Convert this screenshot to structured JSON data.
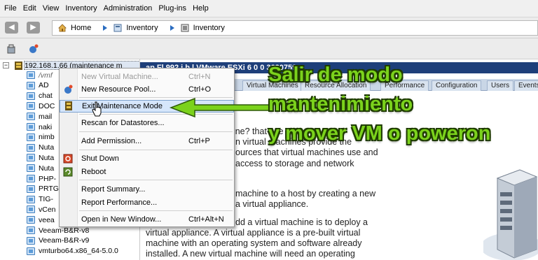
{
  "menubar": [
    "File",
    "Edit",
    "View",
    "Inventory",
    "Administration",
    "Plug-ins",
    "Help"
  ],
  "breadcrumb": [
    {
      "label": "Home",
      "icon": "home-icon"
    },
    {
      "label": "Inventory",
      "icon": "inventory-icon"
    },
    {
      "label": "Inventory",
      "icon": "inventory-icon"
    }
  ],
  "tree": {
    "host": "192.168.1.66 (maintenance m",
    "items": [
      "/vmf",
      "AD",
      "chat",
      "DOC",
      "mail",
      "naki",
      "nimb",
      "Nuta",
      "Nuta",
      "Nuta",
      "PHP-",
      "PRTG",
      "TIG-",
      "vCen",
      "veea",
      "Veeam-B&R-v8",
      "Veeam-B&R-v9",
      "vmturbo64.x86_64-5.0.0"
    ]
  },
  "main": {
    "title": "ap Fl 992 i  b l  VMware ESXi 6 0 0 3620759",
    "tabs": [
      "Virtual Machines",
      "Resource Allocation",
      "Performance",
      "Configuration",
      "Users",
      "Events"
    ],
    "paragraphs": [
      "What is a virtual machine? that use",
      "n virtual machines provide the",
      "ources that virtual machines use and",
      "access to storage and network",
      "machine to a host by creating a new",
      "a virtual appliance.",
      "dd a virtual machine is to deploy a",
      "virtual appliance. A virtual appliance is a pre-built virtual",
      "machine with an operating system and software already",
      "installed. A new virtual machine will need an operating"
    ]
  },
  "context_menu": {
    "items": [
      {
        "label": "New Virtual Machine...",
        "shortcut": "Ctrl+N",
        "disabled": true
      },
      {
        "label": "New Resource Pool...",
        "shortcut": "Ctrl+O"
      },
      {
        "label": "Exit Maintenance Mode",
        "shortcut": "",
        "highlighted": true
      },
      {
        "label": "Rescan for Datastores...",
        "shortcut": ""
      },
      {
        "label": "Add Permission...",
        "shortcut": "Ctrl+P"
      },
      {
        "label": "Shut Down",
        "shortcut": ""
      },
      {
        "label": "Reboot",
        "shortcut": ""
      },
      {
        "label": "Report Summary...",
        "shortcut": ""
      },
      {
        "label": "Report Performance...",
        "shortcut": ""
      },
      {
        "label": "Open in New Window...",
        "shortcut": "Ctrl+Alt+N"
      }
    ]
  },
  "overlay": [
    "Salir de modo",
    "mantenimiento",
    "y mover VM o poweron"
  ],
  "colors": {
    "accent": "#7bd21c",
    "titlebar": "#1e3f7a",
    "highlight": "#d6e6fb"
  }
}
